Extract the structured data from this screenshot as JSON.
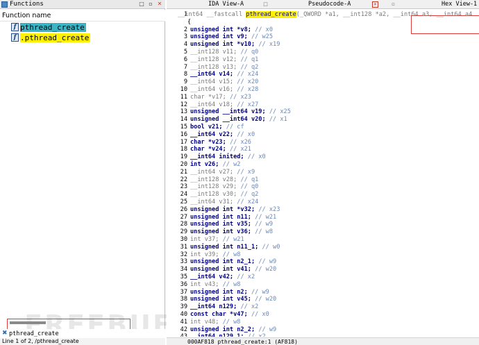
{
  "functions_panel": {
    "title": "Functions",
    "column_header": "Function name",
    "items": [
      {
        "icon": "f",
        "name": "pthread_create",
        "style": "selected"
      },
      {
        "icon": "f",
        "name": ".pthread_create",
        "style": "highlight"
      }
    ],
    "search_value": "pthread_create",
    "status": "Line 1 of 2, /pthread_create"
  },
  "tabs": [
    {
      "label": "IDA View-A"
    },
    {
      "label": "Pseudocode-A"
    },
    {
      "label": "Hex View-1"
    }
  ],
  "code": {
    "signature": {
      "prefix": "__int64 __fastcall ",
      "func": "pthread_create",
      "suffix": "(_QWORD *a1, __int128 *a2, __int64 a3, __int64 a4"
    },
    "open_brace": "{",
    "lines": [
      {
        "n": "1",
        "text": "__int64 __fastcall pthread_create(_QWORD *a1, __int128 *a2, __int64 a3, __int64 a4"
      },
      {
        "n": "",
        "text": "{"
      },
      {
        "n": "2",
        "decl": "unsigned int *v8;",
        "comment": "// x0",
        "dim": false
      },
      {
        "n": "3",
        "decl": "unsigned int v9;",
        "comment": "// w25",
        "dim": false
      },
      {
        "n": "4",
        "decl": "unsigned int *v10;",
        "comment": "// x19",
        "dim": false
      },
      {
        "n": "5",
        "decl": "__int128 v11;",
        "comment": "// q0",
        "dim": true
      },
      {
        "n": "6",
        "decl": "__int128 v12;",
        "comment": "// q1",
        "dim": true
      },
      {
        "n": "7",
        "decl": "__int128 v13;",
        "comment": "// q2",
        "dim": true
      },
      {
        "n": "8",
        "decl": "__int64 v14;",
        "comment": "// x24",
        "dim": false
      },
      {
        "n": "9",
        "decl": "__int64 v15;",
        "comment": "// x20",
        "dim": true
      },
      {
        "n": "10",
        "decl": "__int64 v16;",
        "comment": "// x28",
        "dim": true
      },
      {
        "n": "11",
        "decl": "char *v17;",
        "comment": "// x23",
        "dim": true
      },
      {
        "n": "12",
        "decl": "__int64 v18;",
        "comment": "// x27",
        "dim": true
      },
      {
        "n": "13",
        "decl": "unsigned __int64 v19;",
        "comment": "// x25",
        "dim": false
      },
      {
        "n": "14",
        "decl": "unsigned __int64 v20;",
        "comment": "// x1",
        "dim": false
      },
      {
        "n": "15",
        "decl": "bool v21;",
        "comment": "// cf",
        "dim": false
      },
      {
        "n": "16",
        "decl": "__int64 v22;",
        "comment": "// x0",
        "dim": false
      },
      {
        "n": "17",
        "decl": "char *v23;",
        "comment": "// x26",
        "dim": false
      },
      {
        "n": "18",
        "decl": "char *v24;",
        "comment": "// x21",
        "dim": false
      },
      {
        "n": "19",
        "decl": "__int64 inited;",
        "comment": "// x0",
        "dim": false
      },
      {
        "n": "20",
        "decl": "int v26;",
        "comment": "// w2",
        "dim": false
      },
      {
        "n": "21",
        "decl": "__int64 v27;",
        "comment": "// x9",
        "dim": true
      },
      {
        "n": "22",
        "decl": "__int128 v28;",
        "comment": "// q1",
        "dim": true
      },
      {
        "n": "23",
        "decl": "__int128 v29;",
        "comment": "// q0",
        "dim": true
      },
      {
        "n": "24",
        "decl": "__int128 v30;",
        "comment": "// q2",
        "dim": true
      },
      {
        "n": "25",
        "decl": "__int64 v31;",
        "comment": "// x24",
        "dim": true
      },
      {
        "n": "26",
        "decl": "unsigned int *v32;",
        "comment": "// x23",
        "dim": false
      },
      {
        "n": "27",
        "decl": "unsigned int n11;",
        "comment": "// w21",
        "dim": false
      },
      {
        "n": "28",
        "decl": "unsigned int v35;",
        "comment": "// w9",
        "dim": false
      },
      {
        "n": "29",
        "decl": "unsigned int v36;",
        "comment": "// w8",
        "dim": false
      },
      {
        "n": "30",
        "decl": "int v37;",
        "comment": "// w21",
        "dim": true
      },
      {
        "n": "31",
        "decl": "unsigned int n11_1;",
        "comment": "// w0",
        "dim": false
      },
      {
        "n": "32",
        "decl": "int v39;",
        "comment": "// w8",
        "dim": true
      },
      {
        "n": "33",
        "decl": "unsigned int n2_1;",
        "comment": "// w9",
        "dim": false
      },
      {
        "n": "34",
        "decl": "unsigned int v41;",
        "comment": "// w20",
        "dim": false
      },
      {
        "n": "35",
        "decl": "__int64 v42;",
        "comment": "// x2",
        "dim": false
      },
      {
        "n": "36",
        "decl": "int v43;",
        "comment": "// w8",
        "dim": true
      },
      {
        "n": "37",
        "decl": "unsigned int n2;",
        "comment": "// w9",
        "dim": false
      },
      {
        "n": "38",
        "decl": "unsigned int v45;",
        "comment": "// w20",
        "dim": false
      },
      {
        "n": "39",
        "decl": "__int64 n129;",
        "comment": "// x2",
        "dim": false
      },
      {
        "n": "40",
        "decl": "const char *v47;",
        "comment": "// x0",
        "dim": false
      },
      {
        "n": "41",
        "decl": "int v48;",
        "comment": "// w8",
        "dim": true
      },
      {
        "n": "42",
        "decl": "unsigned int n2_2;",
        "comment": "// w9",
        "dim": false
      },
      {
        "n": "43",
        "decl": "__int64 n129_1;",
        "comment": "// x2",
        "dim": false
      }
    ],
    "status": "000AF818 pthread_create:1 (AF818)"
  },
  "watermark": "FREEBUF",
  "colors": {
    "selection": "#3bb5c6",
    "highlight": "#fff200",
    "annotation_box": "#e23a3a",
    "keyword": "#000080",
    "comment": "#6b88b8"
  }
}
